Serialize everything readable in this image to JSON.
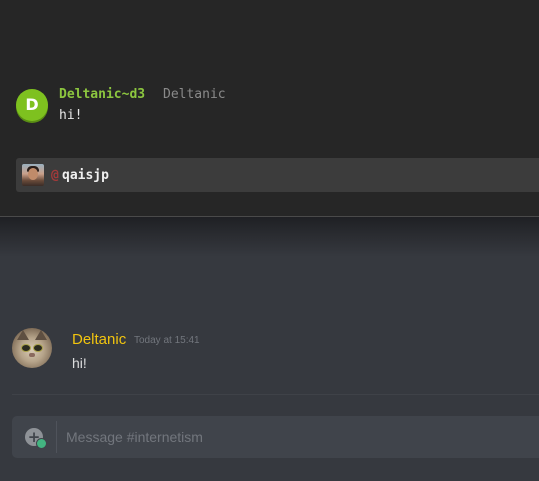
{
  "terminal": {
    "message": {
      "avatar_initial": "D",
      "display_name": "Deltanic~d3",
      "username": "Deltanic",
      "text": "hi!"
    },
    "mention_suggestion": {
      "at_symbol": "@",
      "username": "qaisjp"
    }
  },
  "chat": {
    "message": {
      "author": "Deltanic",
      "timestamp": "Today at 15:41",
      "text": "hi!"
    },
    "input": {
      "placeholder": "Message #internetism",
      "value": ""
    }
  },
  "colors": {
    "terminal_background": "#262626",
    "terminal_name": "#8cc63f",
    "terminal_avatar": "#7ec11f",
    "chat_background": "#36393f",
    "chat_author": "#f1c40f",
    "input_background": "#40444b",
    "upload_badge": "#43b581"
  },
  "icons": {
    "upload": "plus-circle-icon"
  }
}
